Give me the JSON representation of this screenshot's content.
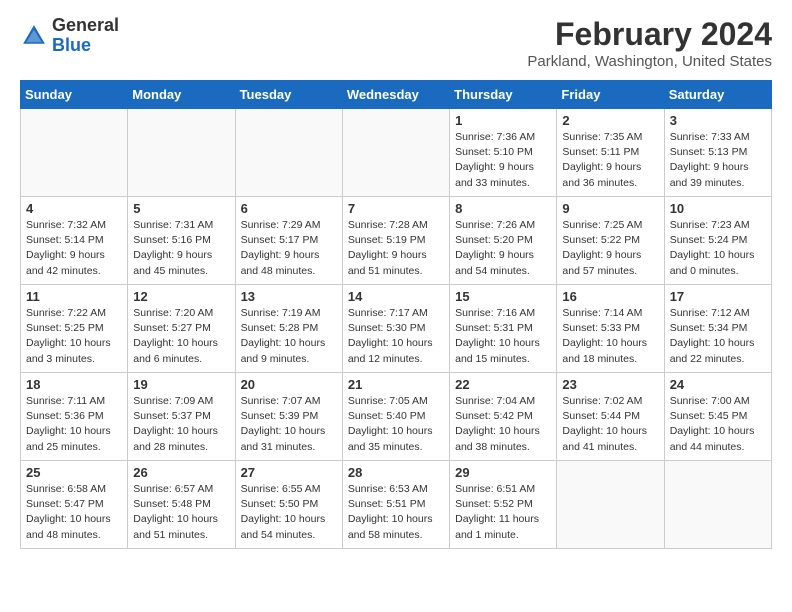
{
  "header": {
    "logo_general": "General",
    "logo_blue": "Blue",
    "month_title": "February 2024",
    "location": "Parkland, Washington, United States"
  },
  "days_of_week": [
    "Sunday",
    "Monday",
    "Tuesday",
    "Wednesday",
    "Thursday",
    "Friday",
    "Saturday"
  ],
  "weeks": [
    [
      {
        "day": "",
        "detail": ""
      },
      {
        "day": "",
        "detail": ""
      },
      {
        "day": "",
        "detail": ""
      },
      {
        "day": "",
        "detail": ""
      },
      {
        "day": "1",
        "detail": "Sunrise: 7:36 AM\nSunset: 5:10 PM\nDaylight: 9 hours\nand 33 minutes."
      },
      {
        "day": "2",
        "detail": "Sunrise: 7:35 AM\nSunset: 5:11 PM\nDaylight: 9 hours\nand 36 minutes."
      },
      {
        "day": "3",
        "detail": "Sunrise: 7:33 AM\nSunset: 5:13 PM\nDaylight: 9 hours\nand 39 minutes."
      }
    ],
    [
      {
        "day": "4",
        "detail": "Sunrise: 7:32 AM\nSunset: 5:14 PM\nDaylight: 9 hours\nand 42 minutes."
      },
      {
        "day": "5",
        "detail": "Sunrise: 7:31 AM\nSunset: 5:16 PM\nDaylight: 9 hours\nand 45 minutes."
      },
      {
        "day": "6",
        "detail": "Sunrise: 7:29 AM\nSunset: 5:17 PM\nDaylight: 9 hours\nand 48 minutes."
      },
      {
        "day": "7",
        "detail": "Sunrise: 7:28 AM\nSunset: 5:19 PM\nDaylight: 9 hours\nand 51 minutes."
      },
      {
        "day": "8",
        "detail": "Sunrise: 7:26 AM\nSunset: 5:20 PM\nDaylight: 9 hours\nand 54 minutes."
      },
      {
        "day": "9",
        "detail": "Sunrise: 7:25 AM\nSunset: 5:22 PM\nDaylight: 9 hours\nand 57 minutes."
      },
      {
        "day": "10",
        "detail": "Sunrise: 7:23 AM\nSunset: 5:24 PM\nDaylight: 10 hours\nand 0 minutes."
      }
    ],
    [
      {
        "day": "11",
        "detail": "Sunrise: 7:22 AM\nSunset: 5:25 PM\nDaylight: 10 hours\nand 3 minutes."
      },
      {
        "day": "12",
        "detail": "Sunrise: 7:20 AM\nSunset: 5:27 PM\nDaylight: 10 hours\nand 6 minutes."
      },
      {
        "day": "13",
        "detail": "Sunrise: 7:19 AM\nSunset: 5:28 PM\nDaylight: 10 hours\nand 9 minutes."
      },
      {
        "day": "14",
        "detail": "Sunrise: 7:17 AM\nSunset: 5:30 PM\nDaylight: 10 hours\nand 12 minutes."
      },
      {
        "day": "15",
        "detail": "Sunrise: 7:16 AM\nSunset: 5:31 PM\nDaylight: 10 hours\nand 15 minutes."
      },
      {
        "day": "16",
        "detail": "Sunrise: 7:14 AM\nSunset: 5:33 PM\nDaylight: 10 hours\nand 18 minutes."
      },
      {
        "day": "17",
        "detail": "Sunrise: 7:12 AM\nSunset: 5:34 PM\nDaylight: 10 hours\nand 22 minutes."
      }
    ],
    [
      {
        "day": "18",
        "detail": "Sunrise: 7:11 AM\nSunset: 5:36 PM\nDaylight: 10 hours\nand 25 minutes."
      },
      {
        "day": "19",
        "detail": "Sunrise: 7:09 AM\nSunset: 5:37 PM\nDaylight: 10 hours\nand 28 minutes."
      },
      {
        "day": "20",
        "detail": "Sunrise: 7:07 AM\nSunset: 5:39 PM\nDaylight: 10 hours\nand 31 minutes."
      },
      {
        "day": "21",
        "detail": "Sunrise: 7:05 AM\nSunset: 5:40 PM\nDaylight: 10 hours\nand 35 minutes."
      },
      {
        "day": "22",
        "detail": "Sunrise: 7:04 AM\nSunset: 5:42 PM\nDaylight: 10 hours\nand 38 minutes."
      },
      {
        "day": "23",
        "detail": "Sunrise: 7:02 AM\nSunset: 5:44 PM\nDaylight: 10 hours\nand 41 minutes."
      },
      {
        "day": "24",
        "detail": "Sunrise: 7:00 AM\nSunset: 5:45 PM\nDaylight: 10 hours\nand 44 minutes."
      }
    ],
    [
      {
        "day": "25",
        "detail": "Sunrise: 6:58 AM\nSunset: 5:47 PM\nDaylight: 10 hours\nand 48 minutes."
      },
      {
        "day": "26",
        "detail": "Sunrise: 6:57 AM\nSunset: 5:48 PM\nDaylight: 10 hours\nand 51 minutes."
      },
      {
        "day": "27",
        "detail": "Sunrise: 6:55 AM\nSunset: 5:50 PM\nDaylight: 10 hours\nand 54 minutes."
      },
      {
        "day": "28",
        "detail": "Sunrise: 6:53 AM\nSunset: 5:51 PM\nDaylight: 10 hours\nand 58 minutes."
      },
      {
        "day": "29",
        "detail": "Sunrise: 6:51 AM\nSunset: 5:52 PM\nDaylight: 11 hours\nand 1 minute."
      },
      {
        "day": "",
        "detail": ""
      },
      {
        "day": "",
        "detail": ""
      }
    ]
  ]
}
